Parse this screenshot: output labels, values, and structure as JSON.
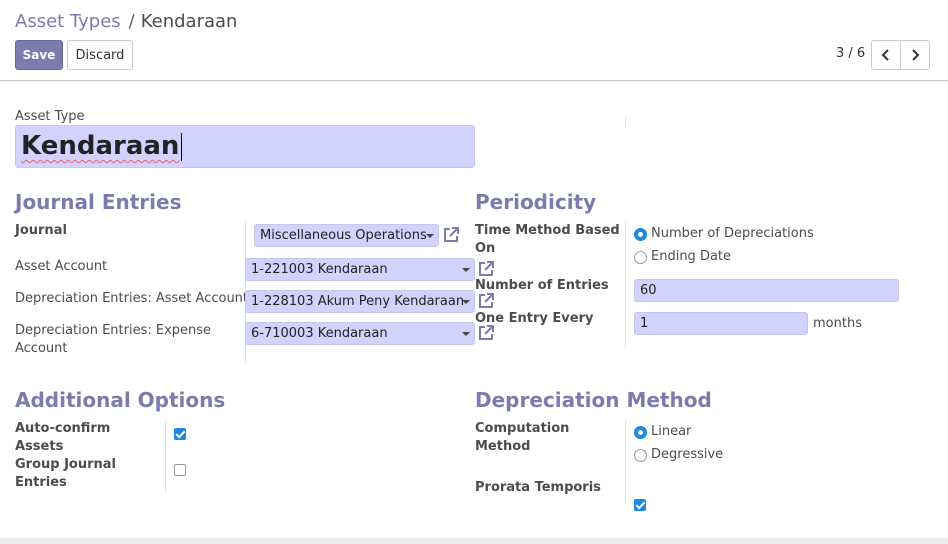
{
  "breadcrumb": {
    "parent": "Asset Types",
    "separator": "/",
    "current": "Kendaraan"
  },
  "toolbar": {
    "save_label": "Save",
    "discard_label": "Discard"
  },
  "pager": {
    "value": "3 / 6"
  },
  "form": {
    "asset_type_label": "Asset Type",
    "asset_type_value": "Kendaraan",
    "journal_entries": {
      "title": "Journal Entries",
      "journal_label": "Journal",
      "journal_value": "Miscellaneous Operations",
      "asset_account_label": "Asset Account",
      "asset_account_value": "1-221003 Kendaraan",
      "dep_asset_label": "Depreciation Entries: Asset Account",
      "dep_asset_value": "1-228103 Akum Peny Kendaraan",
      "dep_expense_label_1": "Depreciation Entries: Expense",
      "dep_expense_label_2": "Account",
      "dep_expense_value": "6-710003 Kendaraan"
    },
    "periodicity": {
      "title": "Periodicity",
      "time_method_label_1": "Time Method Based",
      "time_method_label_2": "On",
      "option_number": "Number of Depreciations",
      "option_ending": "Ending Date",
      "selected": "Number of Depreciations",
      "entries_label": "Number of Entries",
      "entries_value": "60",
      "every_label": "One Entry Every",
      "every_value": "1",
      "every_unit": "months"
    },
    "additional": {
      "title": "Additional Options",
      "auto_confirm_label_1": "Auto-confirm",
      "auto_confirm_label_2": "Assets",
      "auto_confirm_checked": true,
      "group_label_1": "Group Journal",
      "group_label_2": "Entries",
      "group_checked": false
    },
    "depreciation": {
      "title": "Depreciation Method",
      "computation_label_1": "Computation",
      "computation_label_2": "Method",
      "option_linear": "Linear",
      "option_degressive": "Degressive",
      "selected": "Linear",
      "prorata_label": "Prorata Temporis",
      "prorata_checked": true
    }
  },
  "colors": {
    "accent": "#7c7bad",
    "input_bg": "#d2d2ff",
    "check": "#1e88e5"
  },
  "icons": {
    "external": "external-link-icon",
    "prev": "chevron-left-icon",
    "next": "chevron-right-icon"
  }
}
